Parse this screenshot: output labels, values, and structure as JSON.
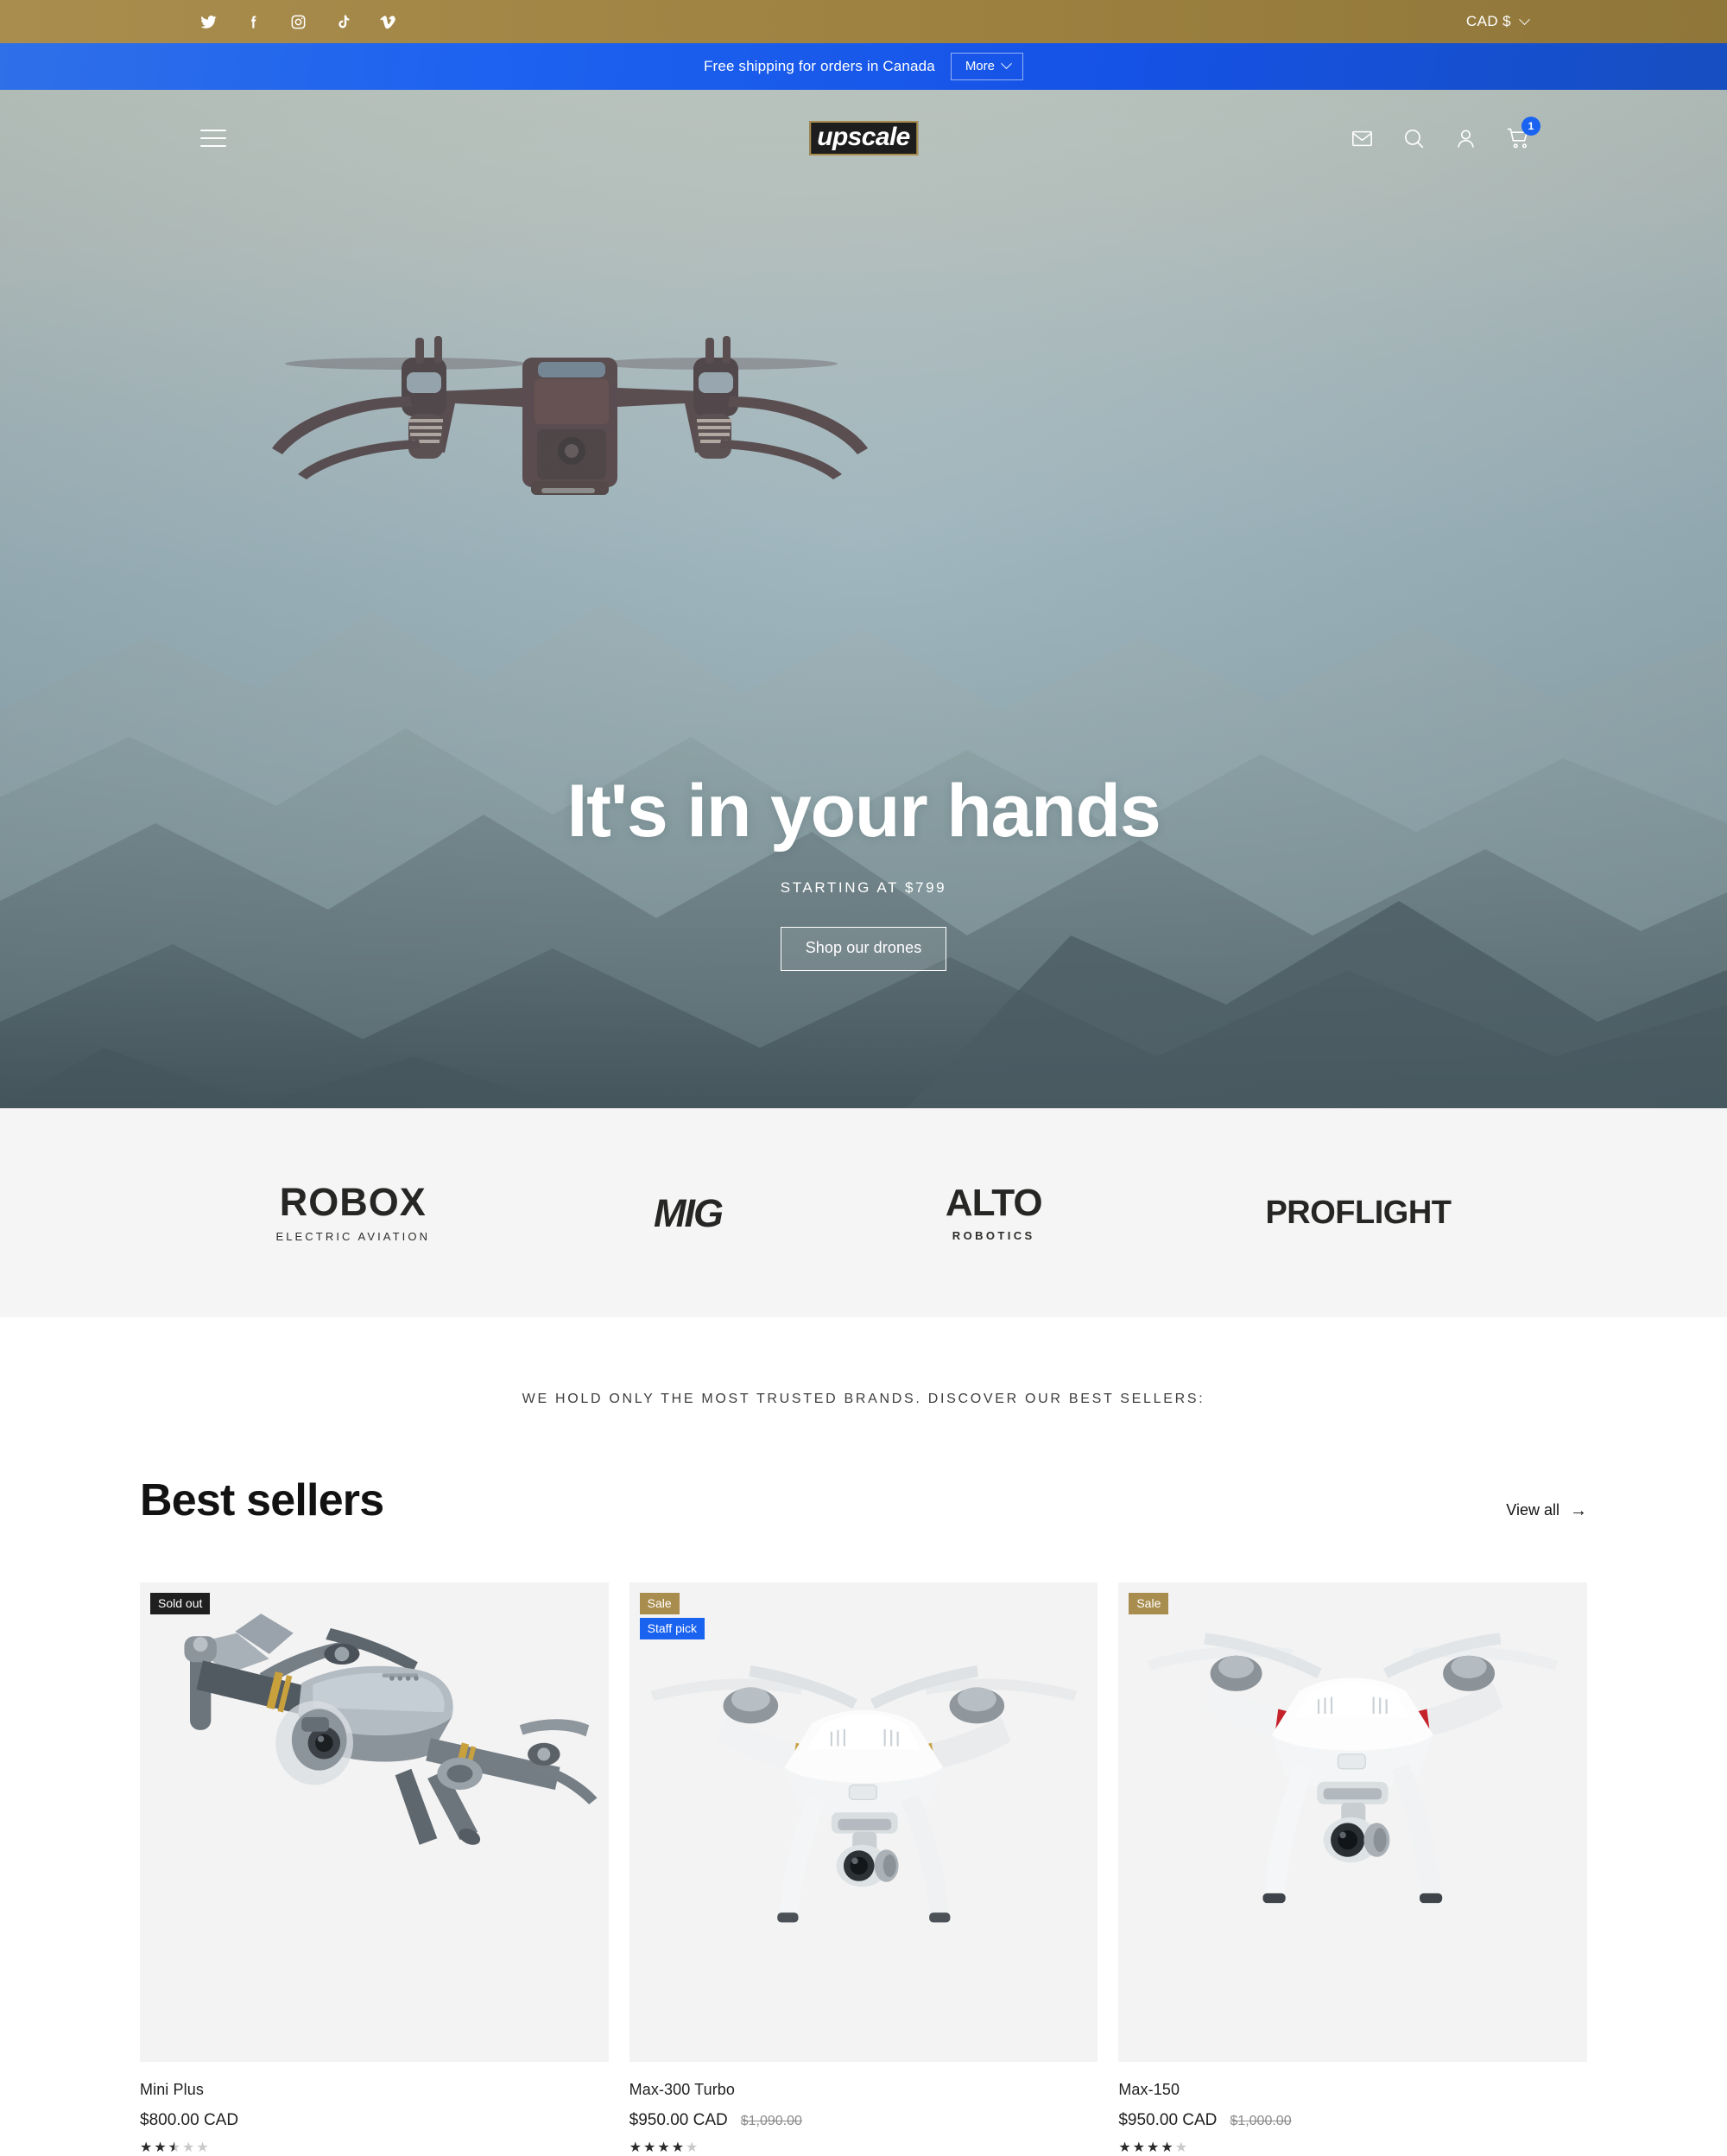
{
  "topbar": {
    "social": [
      {
        "name": "twitter-icon",
        "label": "Twitter"
      },
      {
        "name": "facebook-icon",
        "label": "Facebook"
      },
      {
        "name": "instagram-icon",
        "label": "Instagram"
      },
      {
        "name": "tiktok-icon",
        "label": "TikTok"
      },
      {
        "name": "vimeo-icon",
        "label": "Vimeo"
      }
    ],
    "currency": "CAD $",
    "background_color": "#9d8141"
  },
  "announcement": {
    "text": "Free shipping for orders in Canada",
    "more_label": "More",
    "background_color": "#1d62f0"
  },
  "header": {
    "logo": "upscale",
    "menu_icon": "hamburger-icon",
    "icons": [
      "mail-icon",
      "search-icon",
      "account-icon",
      "cart-icon"
    ],
    "cart_count": "1"
  },
  "hero": {
    "title": "It's in your hands",
    "subtitle": "STARTING AT $799",
    "cta": "Shop our drones"
  },
  "brands": [
    {
      "name": "ROBOX",
      "sub": "ELECTRIC AVIATION",
      "style": "robox"
    },
    {
      "name": "MIG",
      "sub": "",
      "style": "mig"
    },
    {
      "name": "ALTO",
      "sub": "ROBOTICS",
      "style": "alto"
    },
    {
      "name": "PROFLIGHT",
      "sub": "",
      "style": "pro"
    }
  ],
  "tagline": "WE HOLD ONLY THE MOST TRUSTED BRANDS. DISCOVER OUR BEST SELLERS:",
  "best_sellers": {
    "title": "Best sellers",
    "view_all": "View all",
    "products": [
      {
        "title": "Mini Plus",
        "price": "$800.00 CAD",
        "compare_at": "",
        "rating": 2.5,
        "badges": [
          {
            "label": "Sold out",
            "type": "sold"
          }
        ],
        "art": "gray-folding-drone"
      },
      {
        "title": "Max-300 Turbo",
        "price": "$950.00 CAD",
        "compare_at": "$1,090.00",
        "rating": 4,
        "badges": [
          {
            "label": "Sale",
            "type": "sale"
          },
          {
            "label": "Staff pick",
            "type": "staff"
          }
        ],
        "art": "white-gold-quadcopter"
      },
      {
        "title": "Max-150",
        "price": "$950.00 CAD",
        "compare_at": "$1,000.00",
        "rating": 4,
        "badges": [
          {
            "label": "Sale",
            "type": "sale"
          }
        ],
        "art": "white-red-quadcopter"
      }
    ]
  },
  "colors": {
    "gold": "#a98d4e",
    "blue": "#1a62f0",
    "dark": "#1f1f1f",
    "card_bg": "#f3f3f3",
    "brand_strip_bg": "#f5f5f5"
  }
}
